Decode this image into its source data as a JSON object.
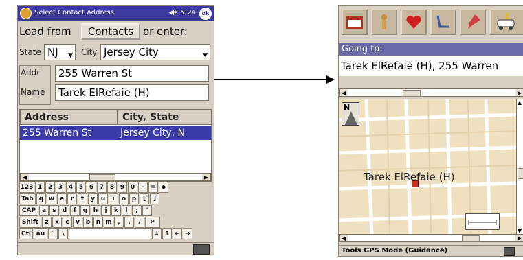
{
  "left_screen": {
    "title": "Select Contact Address",
    "status": "◀€ 5:24",
    "ok_label": "ok",
    "load_from_label": "Load from",
    "contacts_button": "Contacts",
    "or_enter_label": "or enter:",
    "state_label": "State",
    "state_value": "NJ",
    "city_label": "City",
    "city_value": "Jersey City",
    "addr_label": "Addr",
    "addr_value": "255 Warren St",
    "name_label": "Name",
    "name_value": "Tarek ElRefaie (H)",
    "columns": [
      "Address",
      "City, State"
    ],
    "rows": [
      [
        "255 Warren St",
        "Jersey City, N"
      ]
    ],
    "keyboard": [
      [
        "123",
        "1",
        "2",
        "3",
        "4",
        "5",
        "6",
        "7",
        "8",
        "9",
        "0",
        "-",
        "=",
        "◆"
      ],
      [
        "Tab",
        "q",
        "w",
        "e",
        "r",
        "t",
        "y",
        "u",
        "i",
        "o",
        "p",
        "[",
        "]"
      ],
      [
        "CAP",
        "a",
        "s",
        "d",
        "f",
        "g",
        "h",
        "j",
        "k",
        "l",
        ";",
        "'"
      ],
      [
        "Shift",
        "z",
        "x",
        "c",
        "v",
        "b",
        "n",
        "m",
        ",",
        ".",
        "/",
        "↵"
      ],
      [
        "Ctl",
        "áü",
        "`",
        "\\",
        "↓",
        "↑",
        "←",
        "→"
      ]
    ]
  },
  "right_screen": {
    "going_to_label": "Going to:",
    "destination": "Tarek ElRefaie (H), 255 Warren",
    "compass_label": "N",
    "map_label": "Tarek ElRefaie (H)",
    "bottom_menu": "Tools  GPS  Mode  (Guidance)"
  },
  "colors": {
    "title_bar": "#3a3a9a",
    "selection": "#3a3aa8",
    "going_bar": "#6a6aa8",
    "map_bg": "#efe0c0",
    "marker": "#c83020"
  },
  "icons": [
    "calendar-icon",
    "person-icon",
    "heart-icon",
    "chair-icon",
    "pin-icon",
    "car-icon"
  ]
}
